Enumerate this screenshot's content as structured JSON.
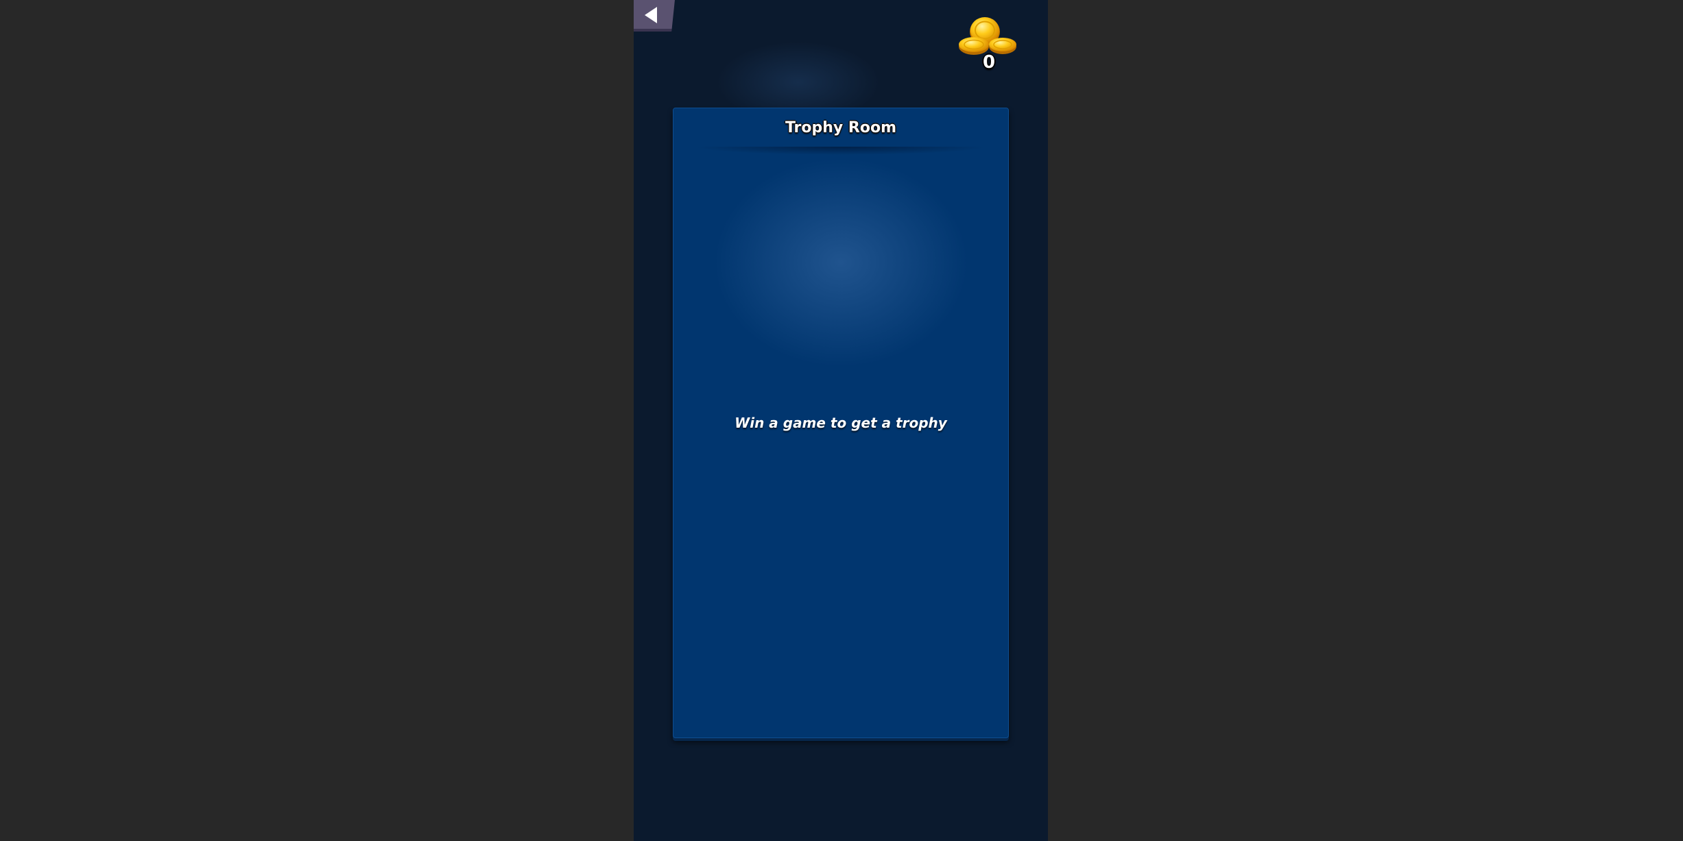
{
  "header": {
    "back_icon": "triangle-left-icon",
    "coin_icon": "gold-coins-icon",
    "coin_count": "0"
  },
  "trophy_panel": {
    "title": "Trophy Room",
    "empty_message": "Win a game to get a trophy"
  },
  "colors": {
    "page_background": "#282828",
    "game_background": "#0b1a2e",
    "panel_background": "#01366f",
    "back_button": "#5a5270",
    "coin_gold": "#f5b800"
  }
}
